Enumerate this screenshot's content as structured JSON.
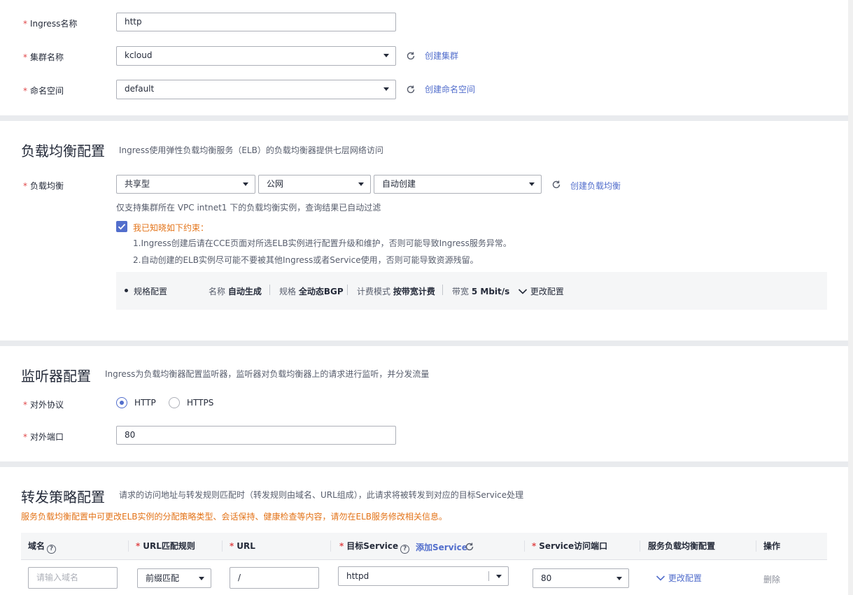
{
  "basic": {
    "ingress_label": "Ingress名称",
    "ingress_value": "http",
    "cluster_label": "集群名称",
    "cluster_value": "kcloud",
    "create_cluster": "创建集群",
    "namespace_label": "命名空间",
    "namespace_value": "default",
    "create_namespace": "创建命名空间"
  },
  "lb": {
    "title": "负载均衡配置",
    "desc": "Ingress使用弹性负载均衡服务（ELB）的负载均衡器提供七层网络访问",
    "label": "负载均衡",
    "type_value": "共享型",
    "network_value": "公网",
    "instance_value": "自动创建",
    "create_lb": "创建负载均衡",
    "vpc_note": "仅支持集群所在 VPC intnet1 下的负载均衡实例，查询结果已自动过滤",
    "agree_label": "我已知晓如下约束：",
    "agree_checked": true,
    "constraint1": "1.Ingress创建后请在CCE页面对所选ELB实例进行配置升级和维护，否则可能导致Ingress服务异常。",
    "constraint2": "2.自动创建的ELB实例尽可能不要被其他Ingress或者Service使用，否则可能导致资源残留。",
    "spec_label": "规格配置",
    "spec_name_key": "名称",
    "spec_name_val": "自动生成",
    "spec_size_key": "规格",
    "spec_size_val": "全动态BGP",
    "spec_billing_key": "计费模式",
    "spec_billing_val": "按带宽计费",
    "spec_bw_key": "带宽",
    "spec_bw_val": "5 Mbit/s",
    "change_config": "更改配置"
  },
  "listener": {
    "title": "监听器配置",
    "desc": "Ingress为负载均衡器配置监听器，监听器对负载均衡器上的请求进行监听，并分发流量",
    "protocol_label": "对外协议",
    "protocol_options": [
      "HTTP",
      "HTTPS"
    ],
    "protocol_selected": "HTTP",
    "port_label": "对外端口",
    "port_value": "80"
  },
  "forward": {
    "title": "转发策略配置",
    "desc": "请求的访问地址与转发规则匹配时（转发规则由域名、URL组成），此请求将被转发到对应的目标Service处理",
    "warning": "服务负载均衡配置中可更改ELB实例的分配策略类型、会话保持、健康检查等内容，请勿在ELB服务修改相关信息。",
    "columns": {
      "domain": "域名",
      "url_rule": "URL匹配规则",
      "url": "URL",
      "target": "目标Service",
      "add_service": "添加Service",
      "port": "Service访问端口",
      "lb_config": "服务负载均衡配置",
      "action": "操作"
    },
    "row": {
      "domain_placeholder": "请输入域名",
      "rule_value": "前缀匹配",
      "url_value": "/",
      "service_value": "httpd",
      "port_value": "80",
      "change_config": "更改配置",
      "delete": "删除"
    }
  },
  "colors": {
    "accent": "#526ecc",
    "required": "#e0484a",
    "warning": "#e37318"
  }
}
